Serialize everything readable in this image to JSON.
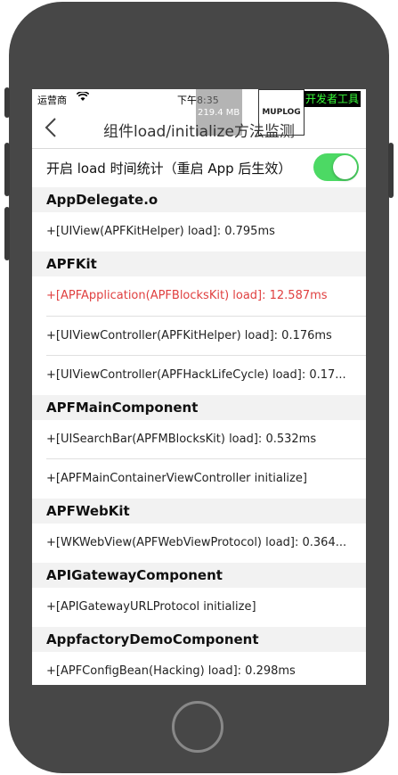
{
  "status_bar": {
    "carrier": "运营商",
    "time": "下午8:35",
    "memory": "219.4 MB",
    "muplog": "MUPLOG",
    "dev_tools": "开发者工具"
  },
  "nav": {
    "title": "组件load/initialize方法监测"
  },
  "toggle": {
    "label": "开启 load 时间统计（重启 App 后生效）",
    "on": true
  },
  "sections": [
    {
      "name": "AppDelegate.o",
      "rows": [
        {
          "text": "+[UIView(APFKitHelper) load]:  0.795ms"
        }
      ]
    },
    {
      "name": "APFKit",
      "rows": [
        {
          "text": "+[APFApplication(APFBlocksKit) load]:  12.587ms",
          "warn": true
        },
        {
          "text": "+[UIViewController(APFKitHelper) load]:  0.176ms"
        },
        {
          "text": "+[UIViewController(APFHackLifeCycle) load]:  0.17..."
        }
      ]
    },
    {
      "name": "APFMainComponent",
      "rows": [
        {
          "text": "+[UISearchBar(APFMBlocksKit) load]:  0.532ms"
        },
        {
          "text": "+[APFMainContainerViewController initialize]"
        }
      ]
    },
    {
      "name": "APFWebKit",
      "rows": [
        {
          "text": "+[WKWebView(APFWebViewProtocol) load]:  0.364..."
        }
      ]
    },
    {
      "name": "APIGatewayComponent",
      "rows": [
        {
          "text": "+[APIGatewayURLProtocol initialize]"
        }
      ]
    },
    {
      "name": "AppfactoryDemoComponent",
      "rows": [
        {
          "text": "+[APFConfigBean(Hacking) load]:  0.298ms"
        }
      ]
    }
  ],
  "colors": {
    "accent_switch": "#4cd964",
    "warning_text": "#e04040"
  }
}
